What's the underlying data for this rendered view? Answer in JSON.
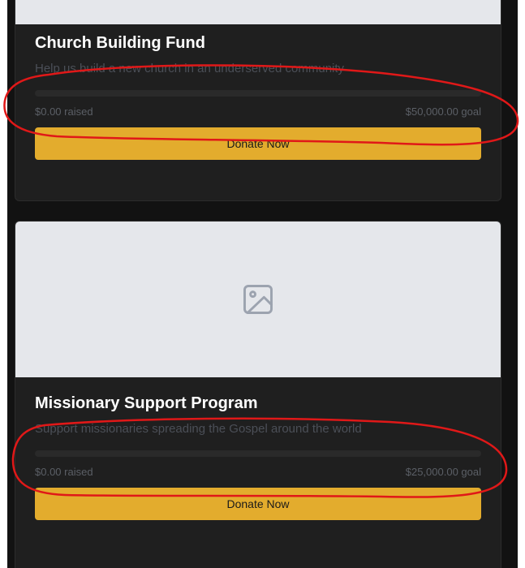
{
  "campaigns": [
    {
      "title": "Church Building Fund",
      "description": "Help us build a new church in an underserved community",
      "raised_label": "$0.00 raised",
      "goal_label": "$50,000.00 goal",
      "progress_fraction": 0,
      "button_label": "Donate Now"
    },
    {
      "title": "Missionary Support Program",
      "description": "Support missionaries spreading the Gospel around the world",
      "raised_label": "$0.00 raised",
      "goal_label": "$25,000.00 goal",
      "progress_fraction": 0,
      "button_label": "Donate Now",
      "image_icon": "image-placeholder-icon"
    }
  ],
  "colors": {
    "background": "#121212",
    "card": "#1f1f1f",
    "accent": "#e3ac2d",
    "image_placeholder": "#e5e7eb",
    "annotation": "#e01818"
  }
}
